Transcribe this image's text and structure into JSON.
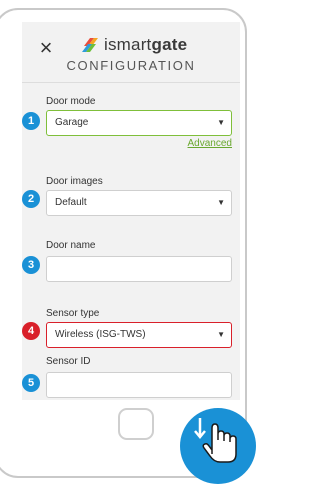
{
  "header": {
    "close_icon": "×",
    "brand_plain": "ismart",
    "brand_bold": "gate",
    "subtitle": "CONFIGURATION"
  },
  "fields": {
    "door_mode": {
      "badge": "1",
      "label": "Door mode",
      "value": "Garage",
      "advanced": "Advanced"
    },
    "door_images": {
      "badge": "2",
      "label": "Door images",
      "value": "Default"
    },
    "door_name": {
      "badge": "3",
      "label": "Door name",
      "value": ""
    },
    "sensor_type": {
      "badge": "4",
      "label": "Sensor type",
      "value": "Wireless (ISG-TWS)"
    },
    "sensor_id": {
      "badge": "5",
      "label": "Sensor ID",
      "value": ""
    }
  },
  "caret": "▼",
  "colors": {
    "badge_blue": "#1a91d6",
    "badge_red": "#d9202a",
    "focus_green": "#7fbf3a",
    "error_red": "#d9202a"
  },
  "icons": [
    "close-icon",
    "ismartgate-logo-icon",
    "tap-hand-icon"
  ]
}
